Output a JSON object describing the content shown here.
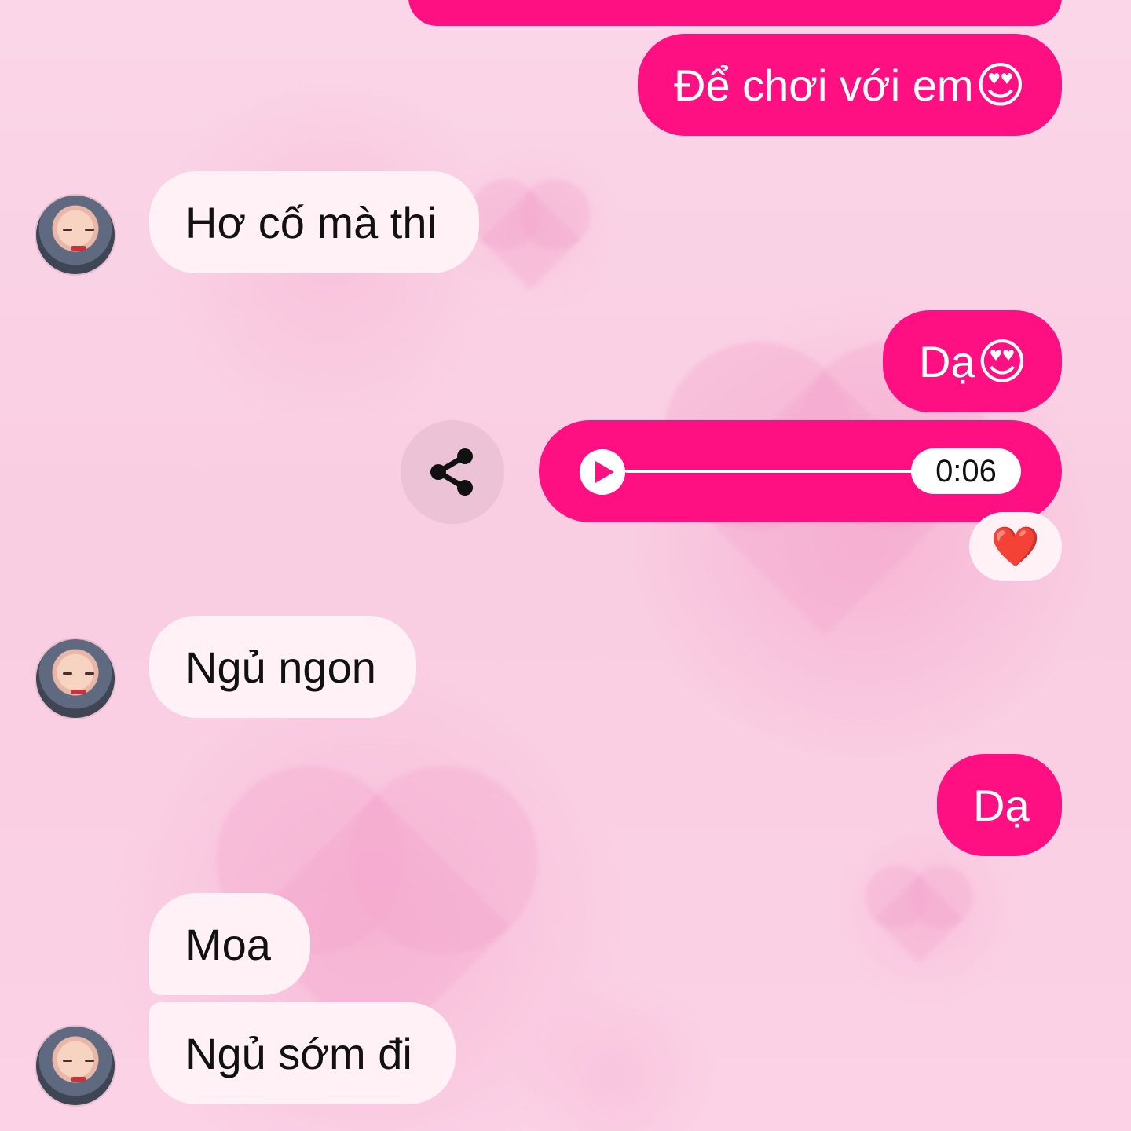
{
  "colors": {
    "outgoing_bubble": "#fe0f82",
    "incoming_bubble": "#fff1f6",
    "background": "#fad4e6",
    "reaction_heart": "#e8202e"
  },
  "messages": [
    {
      "id": "m1",
      "direction": "outgoing",
      "text": "Để chơi với em",
      "emoji": "😍"
    },
    {
      "id": "m2",
      "direction": "incoming",
      "text": "Hơ cố mà thi"
    },
    {
      "id": "m3",
      "direction": "outgoing",
      "text": "Dạ",
      "emoji": "😍"
    },
    {
      "id": "m4",
      "direction": "outgoing",
      "type": "voice",
      "duration": "0:06",
      "reaction": "❤️"
    },
    {
      "id": "m5",
      "direction": "incoming",
      "text": "Ngủ ngon"
    },
    {
      "id": "m6",
      "direction": "outgoing",
      "text": "Dạ"
    },
    {
      "id": "m7",
      "direction": "incoming",
      "text": "Moa"
    },
    {
      "id": "m8",
      "direction": "incoming",
      "text": "Ngủ sớm đi"
    }
  ],
  "icons": {
    "share": "share-icon",
    "play": "play-icon",
    "avatar": "avatar"
  }
}
